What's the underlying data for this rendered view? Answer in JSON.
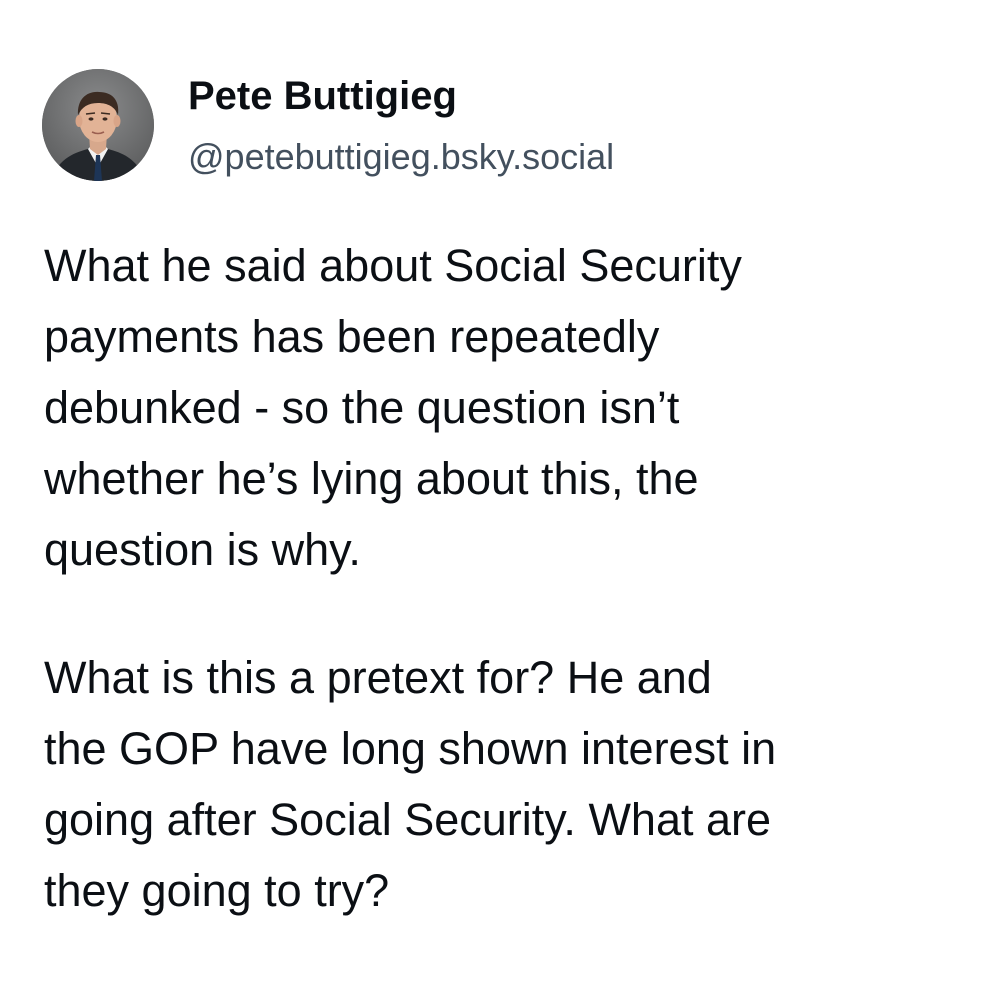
{
  "post": {
    "author": {
      "display_name": "Pete Buttigieg",
      "handle": "@petebuttigieg.bsky.social",
      "avatar_icon": "profile-photo"
    },
    "paragraphs": [
      {
        "lines": [
          "What he said about Social Security",
          "payments has been repeatedly",
          "debunked - so the question isn’t",
          "whether he’s lying about this, the",
          "question is why."
        ]
      },
      {
        "lines": [
          "What is this a pretext for? He and",
          "the GOP have long shown interest in",
          "going after Social Security. What are",
          "they going to try?"
        ]
      }
    ]
  },
  "colors": {
    "background": "#ffffff",
    "text": "#0b0f14",
    "handle": "#43505e"
  }
}
